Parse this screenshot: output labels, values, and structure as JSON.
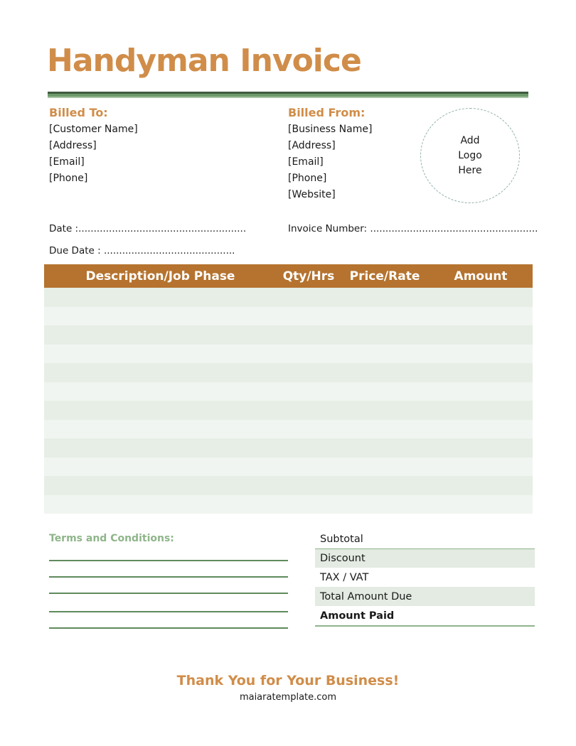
{
  "header": {
    "title": "Handyman Invoice"
  },
  "billed_to": {
    "heading": "Billed To:",
    "lines": [
      "[Customer Name]",
      "[Address]",
      "[Email]",
      "[Phone]"
    ]
  },
  "billed_from": {
    "heading": "Billed From:",
    "lines": [
      "[Business Name]",
      "[Address]",
      "[Email]",
      "[Phone]",
      "[Website]"
    ]
  },
  "logo_placeholder": {
    "lines": [
      "Add",
      "Logo",
      "Here"
    ]
  },
  "meta": {
    "date_label": "Date :",
    "date_value": ".......................................................",
    "due_date_label": "Due Date :",
    "due_date_value": " ...........................................",
    "invoice_number_label": "Invoice Number:",
    "invoice_number_value": " ......................................................."
  },
  "items_table": {
    "columns": [
      "Description/Job Phase",
      "Qty/Hrs",
      "Price/Rate",
      "Amount"
    ],
    "rows": [
      [
        "",
        "",
        "",
        ""
      ],
      [
        "",
        "",
        "",
        ""
      ],
      [
        "",
        "",
        "",
        ""
      ],
      [
        "",
        "",
        "",
        ""
      ],
      [
        "",
        "",
        "",
        ""
      ],
      [
        "",
        "",
        "",
        ""
      ],
      [
        "",
        "",
        "",
        ""
      ],
      [
        "",
        "",
        "",
        ""
      ],
      [
        "",
        "",
        "",
        ""
      ],
      [
        "",
        "",
        "",
        ""
      ],
      [
        "",
        "",
        "",
        ""
      ],
      [
        "",
        "",
        "",
        ""
      ]
    ]
  },
  "terms": {
    "heading": "Terms and Conditions:",
    "line_count": 5
  },
  "totals": {
    "rows": [
      {
        "label": "Subtotal",
        "value": ""
      },
      {
        "label": "Discount",
        "value": ""
      },
      {
        "label": "TAX / VAT",
        "value": ""
      },
      {
        "label": "Total Amount Due",
        "value": ""
      },
      {
        "label": "Amount Paid",
        "value": ""
      }
    ]
  },
  "footer": {
    "thank_you": "Thank You for Your Business!",
    "website": "maiaratemplate.com"
  },
  "colors": {
    "accent_orange": "#d08d49",
    "table_header": "#b5732f",
    "accent_green": "#6e9a6b",
    "row_dark": "#e6eee6",
    "row_light": "#f1f5f1"
  }
}
